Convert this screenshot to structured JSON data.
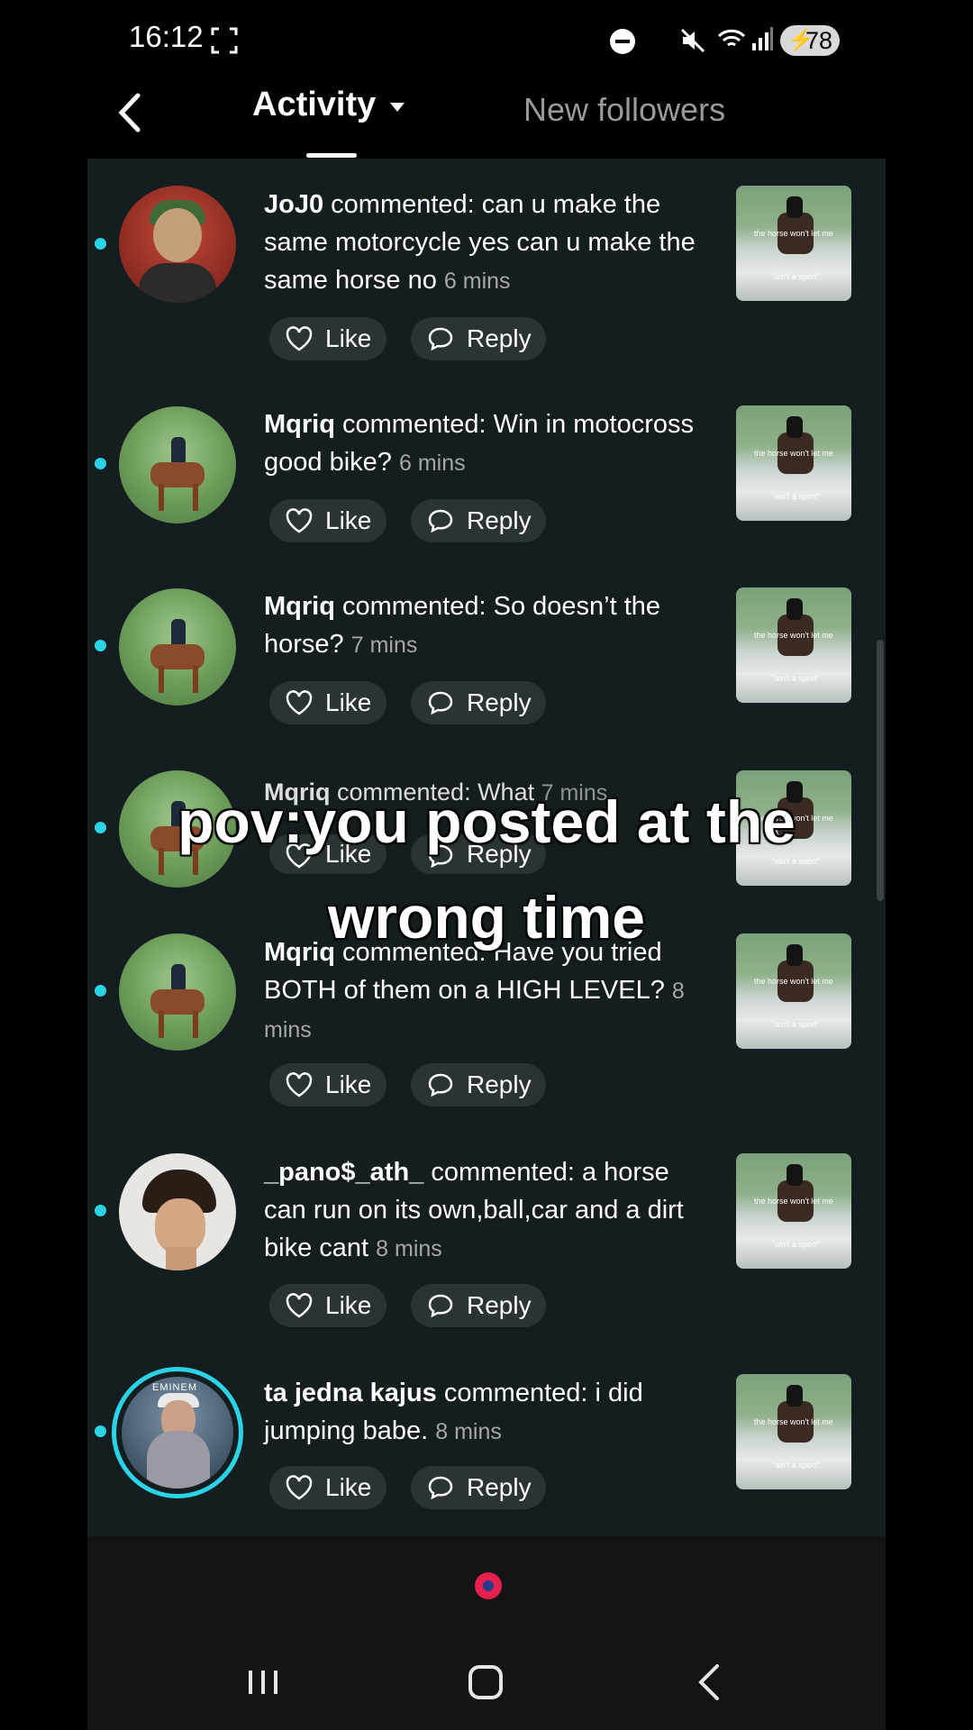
{
  "status_bar": {
    "time": "16:12",
    "battery": "78"
  },
  "header": {
    "tab_active": "Activity",
    "tab_other": "New followers"
  },
  "notifications": [
    {
      "user": "JoJ0",
      "text": " commented: can u make the same motorcycle yes can u make the same horse no ",
      "time": "6 mins"
    },
    {
      "user": "Mqriq",
      "text": " commented: Win in motocross good bike? ",
      "time": "6 mins"
    },
    {
      "user": "Mqriq",
      "text": " commented: So doesn’t the horse? ",
      "time": "7 mins"
    },
    {
      "user": "Mqriq",
      "text": " commented: What ",
      "time": "7 mins"
    },
    {
      "user": "Mqriq",
      "text": " commented: Have you tried BOTH of them on a HIGH LEVEL? ",
      "time": "8 mins"
    },
    {
      "user": "_pano$_ath_",
      "text": " commented: a horse can run on its own,ball,car and a dirt bike cant ",
      "time": "8 mins"
    },
    {
      "user": "ta jedna kajus",
      "text": " commented: i did jumping babe. ",
      "time": "8 mins"
    }
  ],
  "actions": {
    "like": "Like",
    "reply": "Reply"
  },
  "overlay": {
    "line1": "pov:you posted at the",
    "line2": "wrong time"
  },
  "thumb_caption_top": "the horse won't let me",
  "thumb_caption_bottom": "\"ain't a sport\"",
  "colors": {
    "accent_dot": "#2bd3e6",
    "background": "#141d1f",
    "recorder": "#e5204e"
  }
}
